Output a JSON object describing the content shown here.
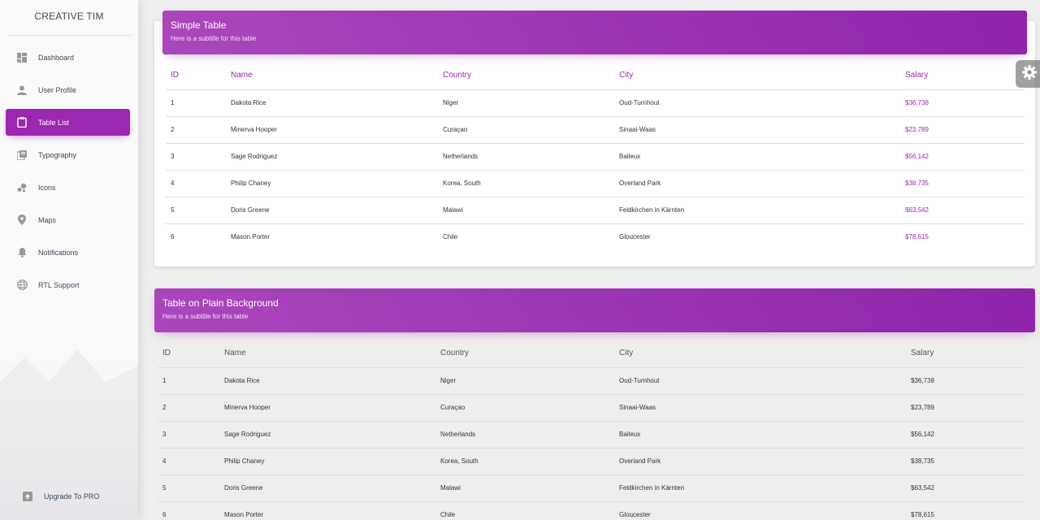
{
  "sidebar": {
    "brand": "CREATIVE TIM",
    "items": [
      {
        "label": "Dashboard",
        "icon": "dashboard-icon"
      },
      {
        "label": "User Profile",
        "icon": "person-icon"
      },
      {
        "label": "Table List",
        "icon": "clipboard-icon",
        "active": true
      },
      {
        "label": "Typography",
        "icon": "library-books-icon"
      },
      {
        "label": "Icons",
        "icon": "bubble-chart-icon"
      },
      {
        "label": "Maps",
        "icon": "location-pin-icon"
      },
      {
        "label": "Notifications",
        "icon": "bell-icon"
      },
      {
        "label": "RTL Support",
        "icon": "globe-icon"
      }
    ],
    "upgrade": {
      "label": "Upgrade To PRO",
      "icon": "unarchive-icon"
    }
  },
  "simple_table": {
    "title": "Simple Table",
    "subtitle": "Here is a subtitle for this table",
    "columns": [
      "ID",
      "Name",
      "Country",
      "City",
      "Salary"
    ],
    "rows": [
      [
        "1",
        "Dakota Rice",
        "Niger",
        "Oud-Turnhout",
        "$36,738"
      ],
      [
        "2",
        "Minerva Hooper",
        "Curaçao",
        "Sinaai-Waas",
        "$23,789"
      ],
      [
        "3",
        "Sage Rodriguez",
        "Netherlands",
        "Baileux",
        "$56,142"
      ],
      [
        "4",
        "Philip Chaney",
        "Korea, South",
        "Overland Park",
        "$38,735"
      ],
      [
        "5",
        "Doris Greene",
        "Malawi",
        "Feldkirchen in Kärnten",
        "$63,542"
      ],
      [
        "6",
        "Mason Porter",
        "Chile",
        "Gloucester",
        "$78,615"
      ]
    ]
  },
  "plain_table": {
    "title": "Table on Plain Background",
    "subtitle": "Here is a subtitle for this table",
    "columns": [
      "ID",
      "Name",
      "Country",
      "City",
      "Salary"
    ],
    "rows": [
      [
        "1",
        "Dakota Rice",
        "Niger",
        "Oud-Turnhout",
        "$36,738"
      ],
      [
        "2",
        "Minerva Hooper",
        "Curaçao",
        "Sinaai-Waas",
        "$23,789"
      ],
      [
        "3",
        "Sage Rodriguez",
        "Netherlands",
        "Baileux",
        "$56,142"
      ],
      [
        "4",
        "Philip Chaney",
        "Korea, South",
        "Overland Park",
        "$38,735"
      ],
      [
        "5",
        "Doris Greene",
        "Malawi",
        "Feldkirchen in Kärnten",
        "$63,542"
      ],
      [
        "6",
        "Mason Porter",
        "Chile",
        "Gloucester",
        "$78,615"
      ]
    ]
  },
  "colors": {
    "accent": "#9c27b0",
    "header_gradient_start": "#ab47bc",
    "header_gradient_end": "#8e24aa"
  },
  "fixed_plugin": {
    "icon": "gear-icon"
  }
}
